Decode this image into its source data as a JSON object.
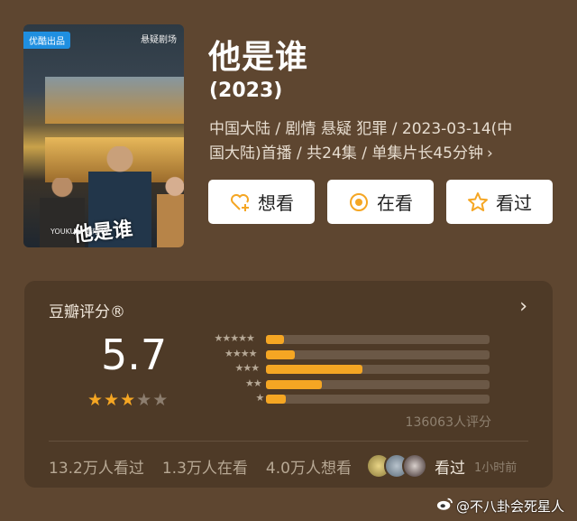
{
  "poster": {
    "badge": "优酷出品",
    "brand": "悬疑剧场",
    "title_art": "他是谁",
    "logos": "YOUKU ▶ 酷喵TV"
  },
  "show": {
    "title": "他是谁",
    "year": "(2023)",
    "meta_line1": "中国大陆 / 剧情 悬疑 犯罪 / 2023-03-14(中",
    "meta_line2": "国大陆)首播 / 共24集 / 单集片长45分钟",
    "meta_more": "›"
  },
  "actions": [
    {
      "label": "想看",
      "icon": "heart-plus-icon"
    },
    {
      "label": "在看",
      "icon": "target-circle-icon"
    },
    {
      "label": "看过",
      "icon": "star-outline-icon"
    }
  ],
  "rating": {
    "header": "豆瓣评分®",
    "more": "›",
    "score": "5.7",
    "stars": 3,
    "stars_total": 5,
    "distribution": [
      {
        "stars": "★★★★★",
        "fraction": 0.08
      },
      {
        "stars": "★★★★",
        "fraction": 0.13
      },
      {
        "stars": "★★★",
        "fraction": 0.43
      },
      {
        "stars": "★★",
        "fraction": 0.25
      },
      {
        "stars": "★",
        "fraction": 0.09
      }
    ],
    "votes": "136063人评分"
  },
  "stats": {
    "watched": "13.2万人看过",
    "watching": "1.3万人在看",
    "want": "4.0万人想看",
    "friends_label": "看过",
    "time": "1小时前"
  },
  "colors": {
    "accent": "#f5a623",
    "background": "#5e4630",
    "panel": "#4e3a27"
  },
  "watermark": "@不八卦会死星人"
}
